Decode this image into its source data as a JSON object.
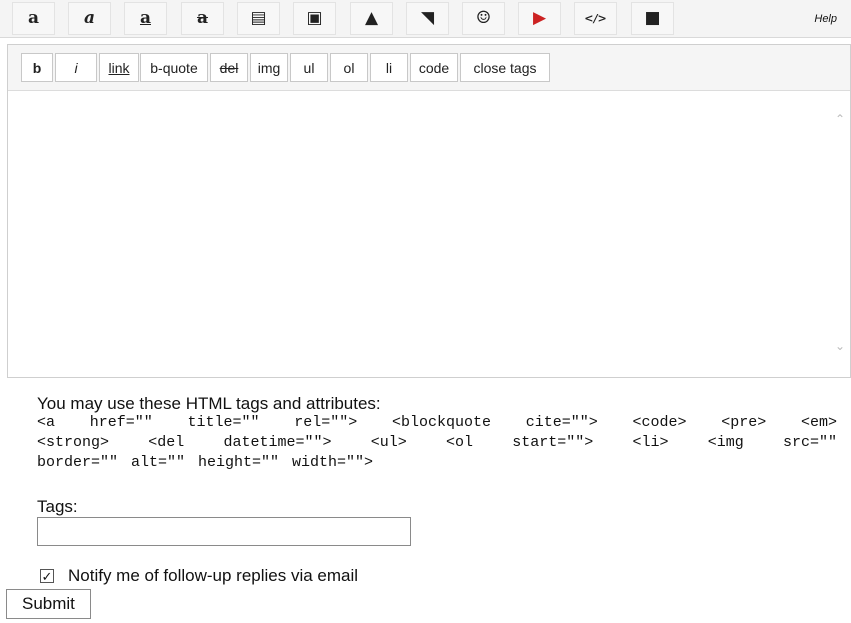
{
  "toolbar": {
    "icons": [
      {
        "name": "font-size-up-icon",
        "glyph": "a"
      },
      {
        "name": "font-italic-icon",
        "glyph": "a"
      },
      {
        "name": "font-underline-icon",
        "glyph": "a"
      },
      {
        "name": "font-strike-icon",
        "glyph": "a"
      },
      {
        "name": "text-block-icon",
        "glyph": "▤"
      },
      {
        "name": "document-icon",
        "glyph": "▣"
      },
      {
        "name": "image-icon",
        "glyph": "▲"
      },
      {
        "name": "photo-icon",
        "glyph": "◥"
      },
      {
        "name": "smiley-icon",
        "glyph": "☺"
      },
      {
        "name": "youtube-icon",
        "glyph": "▶"
      },
      {
        "name": "code-icon",
        "glyph": "</>"
      },
      {
        "name": "box-icon",
        "glyph": "■"
      }
    ],
    "help_label": "Help"
  },
  "quicktags": [
    {
      "label": "b",
      "style": "b"
    },
    {
      "label": "i",
      "style": "i"
    },
    {
      "label": "link",
      "style": "u"
    },
    {
      "label": "b-quote",
      "style": ""
    },
    {
      "label": "del",
      "style": "s"
    },
    {
      "label": "img",
      "style": ""
    },
    {
      "label": "ul",
      "style": ""
    },
    {
      "label": "ol",
      "style": ""
    },
    {
      "label": "li",
      "style": ""
    },
    {
      "label": "code",
      "style": ""
    },
    {
      "label": "close tags",
      "style": ""
    }
  ],
  "editor": {
    "value": ""
  },
  "allowed": {
    "intro": "You may use these HTML tags and attributes:",
    "lines": [
      "<a href=\"\" title=\"\" rel=\"\"> <blockquote cite=\"\"> <code> <pre> <em>",
      "<strong> <del datetime=\"\"> <ul> <ol start=\"\"> <li> <img src=\"\"",
      "border=\"\" alt=\"\" height=\"\" width=\"\">"
    ]
  },
  "tags": {
    "label": "Tags:",
    "value": ""
  },
  "notify": {
    "checked_glyph": "✓",
    "label": "Notify me of follow-up replies via email"
  },
  "submit": {
    "label": "Submit"
  },
  "colors": {
    "toolbar_bg": "#f4f4f4",
    "youtube": "#cc2222",
    "icon": "#222222"
  }
}
